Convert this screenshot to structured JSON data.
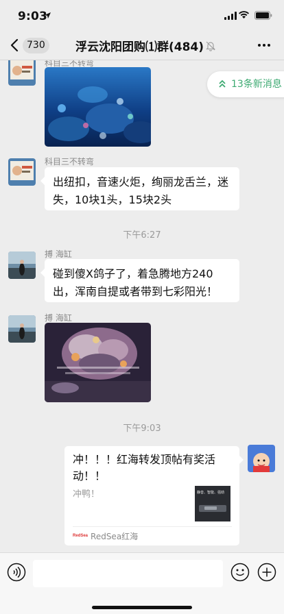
{
  "status": {
    "time": "9:03"
  },
  "nav": {
    "unread_count": "730",
    "title": "浮云沈阳团购⑴群(484)"
  },
  "new_messages": {
    "label": "13条新消息"
  },
  "messages": [
    {
      "sender": "科目三不转弯",
      "type": "image"
    },
    {
      "sender": "科目三不转弯",
      "type": "text",
      "text": "出纽扣，音速火炬，绚丽龙舌兰，迷失，10块1头，15块2头"
    },
    {
      "type": "timestamp",
      "text": "下午6:27"
    },
    {
      "sender": "搏 海缸",
      "type": "text",
      "text": "碰到傻X鸽子了，着急腾地方240出，浑南自提或者带到七彩阳光！"
    },
    {
      "sender": "搏 海缸",
      "type": "image"
    },
    {
      "type": "timestamp",
      "text": "下午9:03"
    },
    {
      "type": "share-card",
      "title": "冲！！！红海转发顶帖有奖活动！！",
      "desc": "冲鸭！",
      "thumb_text": "静音、智能、强劲",
      "source_logo": "RedSea",
      "source": "RedSea红海"
    }
  ],
  "input": {
    "placeholder": ""
  }
}
